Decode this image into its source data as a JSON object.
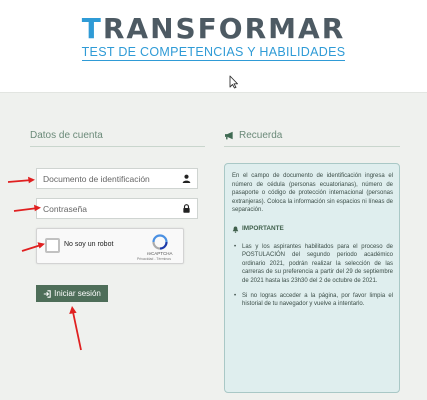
{
  "logo": {
    "main_first": "T",
    "main_rest": "RANSFORMAR",
    "subtitle": "TEST DE COMPETENCIAS Y HABILIDADES"
  },
  "left": {
    "title": "Datos de cuenta",
    "id_placeholder": "Documento de identificación",
    "password_placeholder": "Contraseña",
    "captcha_label": "No soy un robot",
    "captcha_brand": "reCAPTCHA",
    "captcha_terms": "Privacidad - Términos",
    "login_label": "Iniciar sesión"
  },
  "right": {
    "title": "Recuerda",
    "paragraph": "En el campo de documento de identificación ingresa el número de cédula (personas ecuatorianas), número de pasaporte o código de protección internacional (personas extranjeras). Coloca la información sin espacios ni líneas de separación.",
    "important_title": "IMPORTANTE",
    "bullets": [
      "Las y los aspirantes habilitados para el proceso de POSTULACIÓN del segundo periodo académico ordinario 2021, podrán realizar la selección de las carreras de su preferencia a partir del 29 de septiembre de 2021 hasta las 23h30 del 2 de octubre de 2021.",
      "Si no logras acceder a la página, por favor limpia el historial de tu navegador y vuelve a intentarlo."
    ]
  },
  "colors": {
    "brand_blue": "#2f9bd6",
    "logo_gray": "#4d5a63",
    "button_green": "#4e6e59",
    "arrow_red": "#e02020"
  },
  "icons": {
    "id_field": "user-icon",
    "password_field": "lock-icon",
    "login_button": "sign-in-icon",
    "recuerda": "megaphone-icon",
    "important": "bell-icon"
  }
}
